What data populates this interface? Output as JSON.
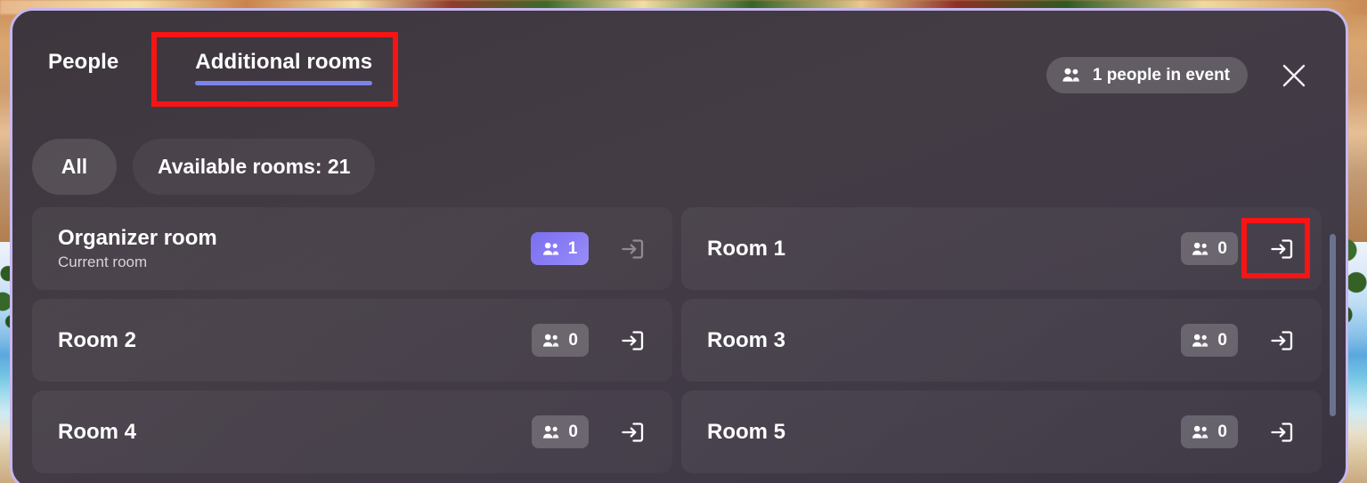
{
  "window": {
    "accent_border_color": "#c7b7ef",
    "panel_background": "#413a44",
    "annotation_color": "#f61414"
  },
  "header": {
    "tabs": [
      {
        "label": "People",
        "selected": false
      },
      {
        "label": "Additional rooms",
        "selected": true
      }
    ],
    "tab_underline_color": "#7b83eb",
    "people_in_event": {
      "label": "1 people in event",
      "icon": "people-icon",
      "count": 1
    },
    "close_label": "Close",
    "close_icon": "close-icon"
  },
  "filters": {
    "chips": [
      {
        "label": "All",
        "selected": true
      },
      {
        "label": "Available rooms: 21",
        "selected": false
      }
    ]
  },
  "rooms": [
    {
      "name": "Organizer room",
      "subtitle": "Current room",
      "count": "1",
      "count_active": true,
      "badge_color": "#8b7ef5",
      "join_icon": "join-room-icon",
      "join_enabled": false
    },
    {
      "name": "Room 1",
      "subtitle": "",
      "count": "0",
      "count_active": false,
      "badge_color": "#6b6670",
      "join_icon": "join-room-icon",
      "join_enabled": true,
      "highlighted": true
    },
    {
      "name": "Room 2",
      "subtitle": "",
      "count": "0",
      "count_active": false,
      "badge_color": "#6b6670",
      "join_icon": "join-room-icon",
      "join_enabled": true
    },
    {
      "name": "Room 3",
      "subtitle": "",
      "count": "0",
      "count_active": false,
      "badge_color": "#6b6670",
      "join_icon": "join-room-icon",
      "join_enabled": true
    },
    {
      "name": "Room 4",
      "subtitle": "",
      "count": "0",
      "count_active": false,
      "badge_color": "#6b6670",
      "join_icon": "join-room-icon",
      "join_enabled": true
    },
    {
      "name": "Room 5",
      "subtitle": "",
      "count": "0",
      "count_active": false,
      "badge_color": "#6b6670",
      "join_icon": "join-room-icon",
      "join_enabled": true
    }
  ],
  "scrollbar": {
    "visible": true,
    "thumb_color": "#69738f"
  }
}
